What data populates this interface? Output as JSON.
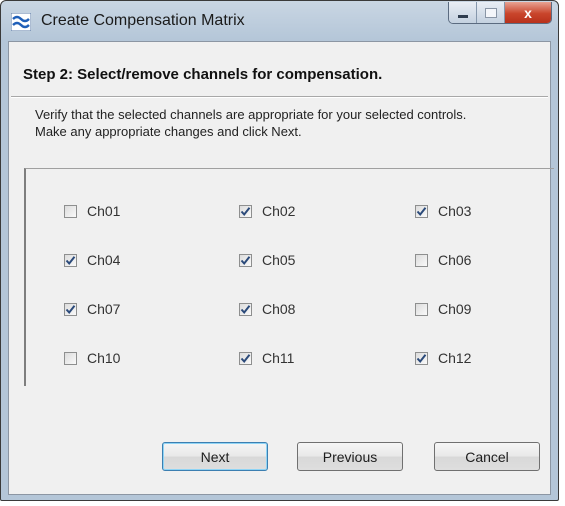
{
  "window": {
    "title": "Create Compensation Matrix",
    "icon": "wave-app-icon",
    "controls": {
      "minimize": "minimize-icon",
      "maximize": "maximize-icon",
      "close": "x"
    }
  },
  "step": {
    "heading": "Step 2:  Select/remove channels for compensation."
  },
  "description": {
    "line1": "Verify that the selected channels are appropriate for your selected controls.",
    "line2": "Make any appropriate changes and click Next."
  },
  "channels": [
    {
      "label": "Ch01",
      "checked": false
    },
    {
      "label": "Ch02",
      "checked": true
    },
    {
      "label": "Ch03",
      "checked": true
    },
    {
      "label": "Ch04",
      "checked": true
    },
    {
      "label": "Ch05",
      "checked": true
    },
    {
      "label": "Ch06",
      "checked": false
    },
    {
      "label": "Ch07",
      "checked": true
    },
    {
      "label": "Ch08",
      "checked": true
    },
    {
      "label": "Ch09",
      "checked": false
    },
    {
      "label": "Ch10",
      "checked": false
    },
    {
      "label": "Ch11",
      "checked": true
    },
    {
      "label": "Ch12",
      "checked": true
    }
  ],
  "buttons": {
    "next": "Next",
    "previous": "Previous",
    "cancel": "Cancel"
  },
  "colors": {
    "title_bar": "#b4c6d8",
    "dialog_bg": "#f0f0f0",
    "check": "#2b4a7a"
  }
}
